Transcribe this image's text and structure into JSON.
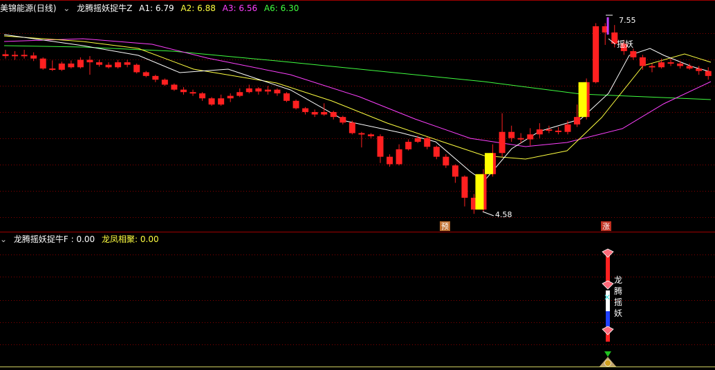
{
  "header": {
    "stock_name": "美锦能源",
    "period": "(日线)",
    "indicator_icon": "collapse-chevron-icon",
    "indicator_name": "龙腾摇妖捉牛Z",
    "a1": "A1: 6.79",
    "a2": "A2: 6.88",
    "a3": "A3: 6.56",
    "a6": "A6: 6.30"
  },
  "sub_header": {
    "indicator_icon": "collapse-chevron-icon",
    "indicator_name": "龙腾摇妖捉牛F : 0.00",
    "value2": "龙凤相聚: 0.00"
  },
  "annotations": {
    "high_price": "7.55",
    "low_price": "4.58",
    "yao_label": "摇妖",
    "yu_marker": "预",
    "zhang_marker": "涨",
    "vertical_text": [
      "龙",
      "腾",
      "摇",
      "妖"
    ]
  },
  "colors": {
    "up": "#ff2020",
    "down": "#ff2020",
    "signal": "#ffff00",
    "a1": "#ffffff",
    "a2": "#ffff40",
    "a3": "#ff40ff",
    "a6": "#40ff40",
    "grid": "#8b0000"
  },
  "chart_data": {
    "type": "candlestick",
    "ylim": [
      4.45,
      7.7
    ],
    "candles": [
      [
        7.05,
        7.02,
        7.12,
        6.98
      ],
      [
        7.02,
        7.04,
        7.1,
        6.96
      ],
      [
        7.04,
        7.03,
        7.12,
        6.98
      ],
      [
        7.03,
        6.98,
        7.08,
        6.94
      ],
      [
        6.98,
        6.82,
        7.0,
        6.8
      ],
      [
        6.82,
        6.8,
        6.95,
        6.78
      ],
      [
        6.8,
        6.9,
        6.93,
        6.78
      ],
      [
        6.9,
        6.84,
        6.95,
        6.82
      ],
      [
        6.84,
        6.96,
        7.0,
        6.82
      ],
      [
        6.96,
        6.92,
        7.02,
        6.72
      ],
      [
        6.92,
        6.88,
        6.96,
        6.85
      ],
      [
        6.88,
        6.84,
        6.92,
        6.82
      ],
      [
        6.84,
        6.92,
        6.96,
        6.82
      ],
      [
        6.92,
        6.88,
        6.96,
        6.84
      ],
      [
        6.88,
        6.76,
        6.9,
        6.74
      ],
      [
        6.76,
        6.7,
        6.78,
        6.68
      ],
      [
        6.7,
        6.64,
        6.72,
        6.6
      ],
      [
        6.64,
        6.56,
        6.66,
        6.54
      ],
      [
        6.56,
        6.48,
        6.58,
        6.46
      ],
      [
        6.48,
        6.44,
        6.52,
        6.4
      ],
      [
        6.44,
        6.42,
        6.48,
        6.38
      ],
      [
        6.42,
        6.34,
        6.44,
        6.3
      ],
      [
        6.34,
        6.24,
        6.36,
        6.22
      ],
      [
        6.24,
        6.34,
        6.4,
        6.22
      ],
      [
        6.34,
        6.38,
        6.42,
        6.28
      ],
      [
        6.38,
        6.44,
        6.5,
        6.36
      ],
      [
        6.44,
        6.5,
        6.56,
        6.42
      ],
      [
        6.5,
        6.45,
        6.52,
        6.4
      ],
      [
        6.45,
        6.48,
        6.54,
        6.4
      ],
      [
        6.48,
        6.42,
        6.5,
        6.38
      ],
      [
        6.42,
        6.3,
        6.44,
        6.28
      ],
      [
        6.3,
        6.18,
        6.32,
        6.16
      ],
      [
        6.18,
        6.12,
        6.2,
        6.08
      ],
      [
        6.12,
        6.08,
        6.16,
        6.04
      ],
      [
        6.08,
        6.12,
        6.26,
        6.06
      ],
      [
        6.12,
        6.04,
        6.14,
        6.0
      ],
      [
        6.04,
        5.95,
        6.06,
        5.92
      ],
      [
        5.95,
        5.78,
        5.98,
        5.76
      ],
      [
        5.78,
        5.76,
        5.8,
        5.55
      ],
      [
        5.76,
        5.73,
        5.78,
        5.7
      ],
      [
        5.73,
        5.4,
        5.76,
        5.3
      ],
      [
        5.4,
        5.28,
        5.44,
        5.24
      ],
      [
        5.28,
        5.52,
        5.6,
        5.26
      ],
      [
        5.52,
        5.64,
        5.68,
        5.5
      ],
      [
        5.64,
        5.7,
        5.74,
        5.62
      ],
      [
        5.7,
        5.56,
        5.72,
        5.52
      ],
      [
        5.56,
        5.4,
        5.58,
        5.36
      ],
      [
        5.4,
        5.26,
        5.44,
        5.22
      ],
      [
        5.26,
        5.08,
        5.28,
        4.98
      ],
      [
        5.08,
        4.74,
        5.1,
        4.6
      ],
      [
        4.74,
        4.55,
        4.8,
        4.48
      ],
      [
        4.55,
        5.12,
        5.2,
        4.52
      ],
      [
        5.12,
        5.46,
        5.6,
        5.08
      ],
      [
        5.46,
        5.8,
        6.1,
        5.4
      ],
      [
        5.8,
        5.7,
        5.9,
        5.64
      ],
      [
        5.7,
        5.68,
        5.78,
        5.62
      ],
      [
        5.68,
        5.76,
        5.86,
        5.58
      ],
      [
        5.76,
        5.84,
        5.94,
        5.7
      ],
      [
        5.84,
        5.82,
        5.9,
        5.78
      ],
      [
        5.82,
        5.8,
        5.88,
        5.76
      ],
      [
        5.8,
        5.92,
        5.98,
        5.76
      ],
      [
        5.92,
        6.04,
        6.24,
        5.88
      ],
      [
        6.04,
        6.6,
        6.66,
        6.0
      ],
      [
        6.6,
        7.5,
        7.55,
        6.58
      ],
      [
        7.5,
        7.4,
        7.55,
        7.2
      ],
      [
        7.4,
        7.22,
        7.52,
        7.16
      ],
      [
        7.22,
        7.1,
        7.28,
        7.04
      ],
      [
        7.1,
        7.0,
        7.14,
        6.96
      ],
      [
        7.0,
        6.86,
        7.04,
        6.8
      ],
      [
        6.86,
        6.84,
        6.9,
        6.76
      ],
      [
        6.84,
        6.92,
        6.98,
        6.82
      ],
      [
        6.92,
        6.9,
        6.98,
        6.86
      ],
      [
        6.9,
        6.86,
        6.94,
        6.82
      ],
      [
        6.86,
        6.82,
        6.9,
        6.8
      ],
      [
        6.82,
        6.78,
        6.86,
        6.72
      ],
      [
        6.78,
        6.7,
        6.84,
        6.64
      ]
    ],
    "signals": [
      {
        "index": 50,
        "open": 4.55,
        "close": 5.12
      },
      {
        "index": 51,
        "open": 5.12,
        "close": 5.46
      },
      {
        "index": 61,
        "open": 6.04,
        "close": 6.6
      }
    ]
  }
}
